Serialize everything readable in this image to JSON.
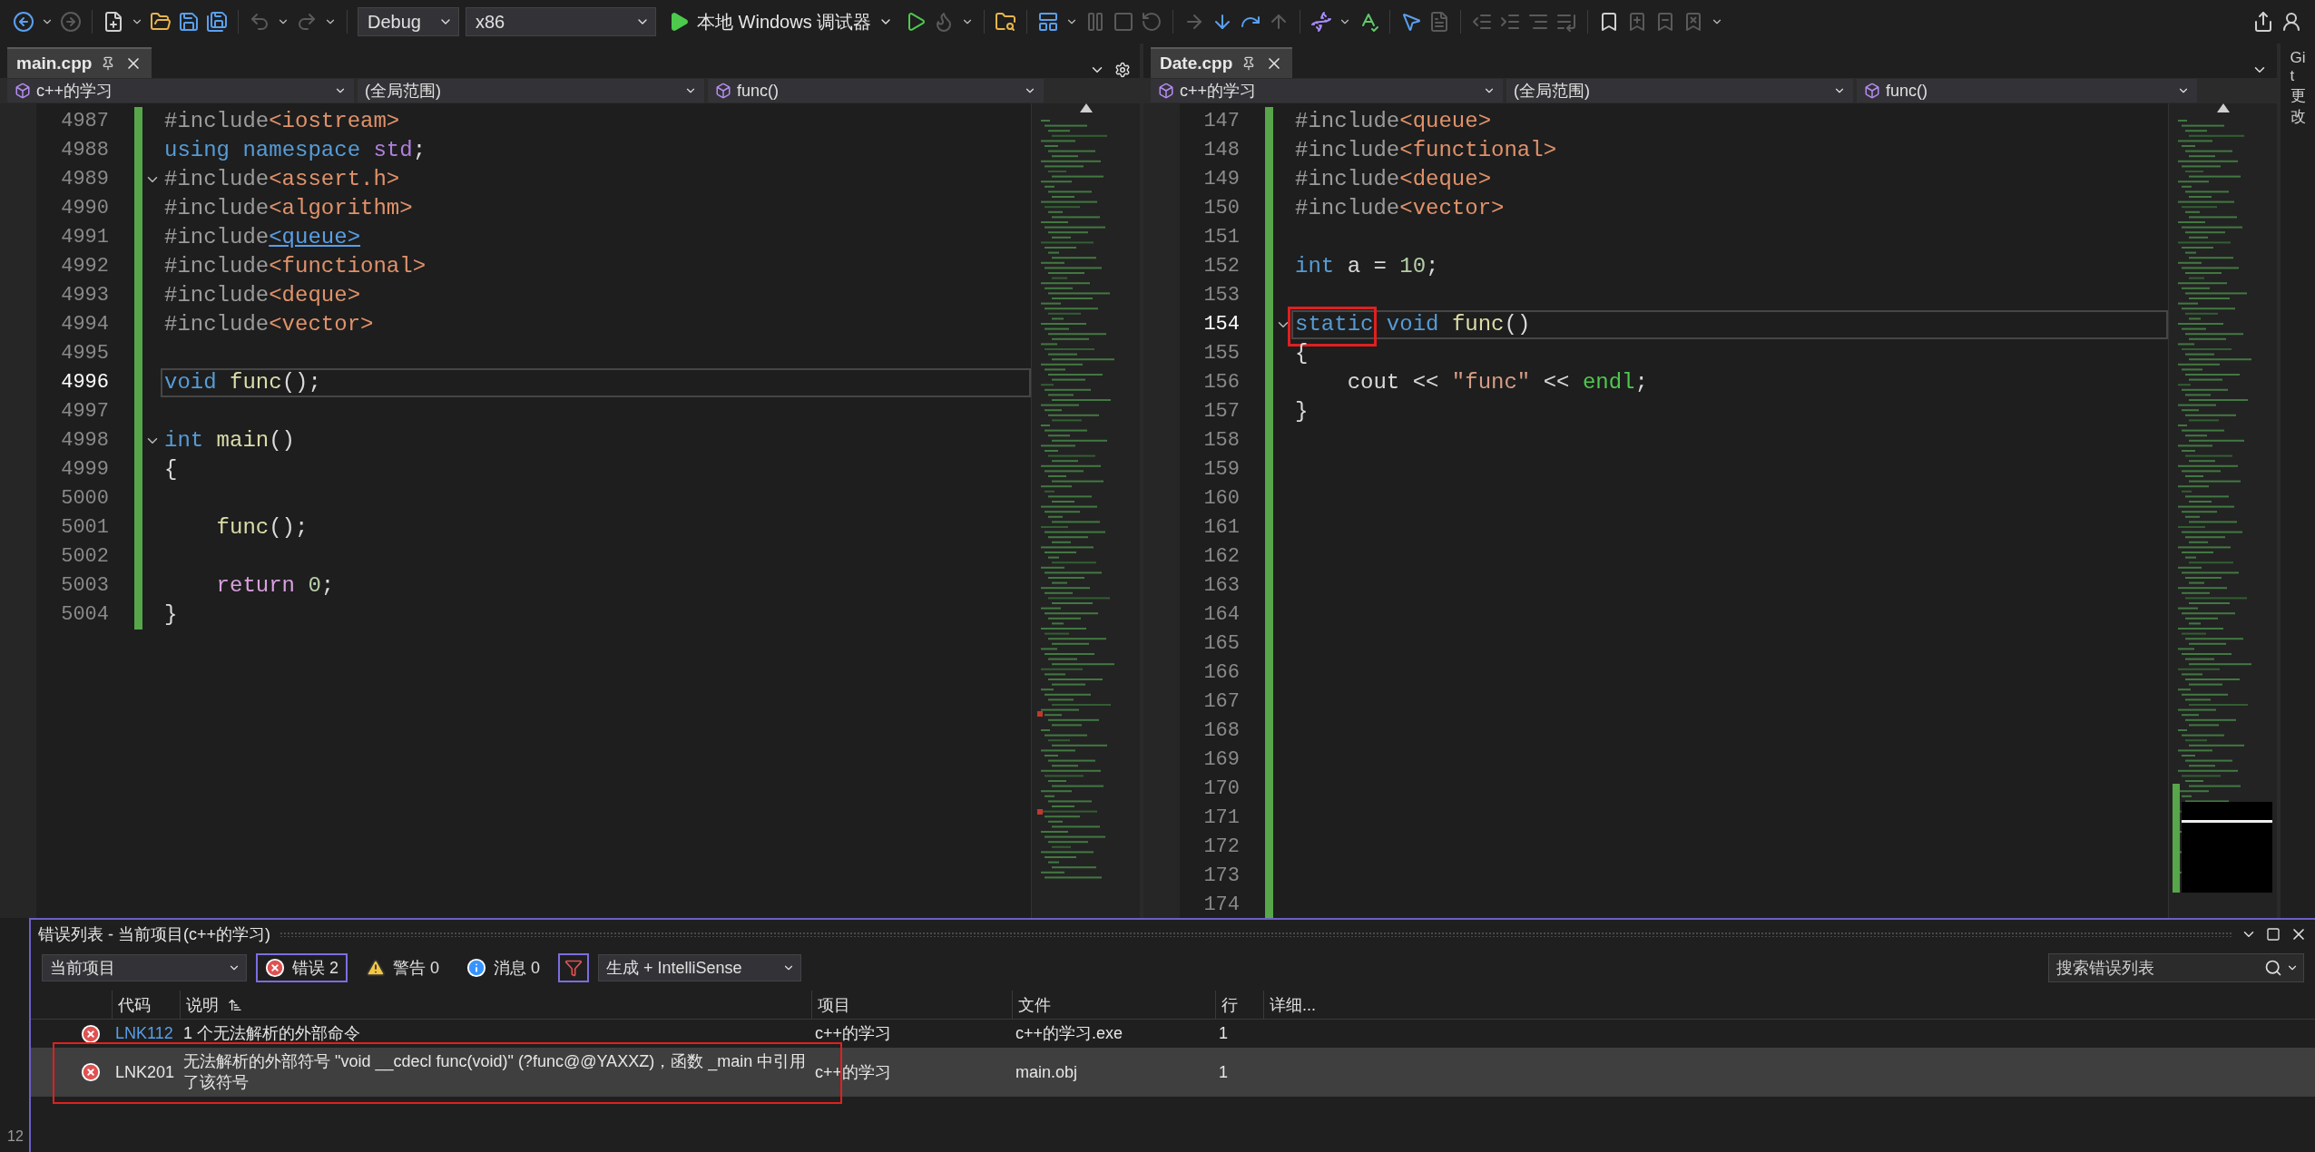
{
  "toolbar": {
    "configuration": "Debug",
    "platform": "x86",
    "run_label": "本地 Windows 调试器",
    "icon_buttons": [
      {
        "disabled": false
      },
      {
        "disabled": true
      },
      {
        "disabled": false
      },
      {
        "disabled": false
      },
      {
        "disabled": false
      },
      {
        "disabled": false
      },
      {
        "disabled": true
      },
      {
        "disabled": true
      },
      {
        "disabled": false
      },
      {
        "disabled": true
      },
      {
        "disabled": false
      },
      {
        "disabled": false
      },
      {
        "disabled": true
      },
      {
        "disabled": true
      },
      {
        "disabled": true
      },
      {
        "disabled": true
      },
      {
        "disabled": false
      },
      {
        "disabled": false
      },
      {
        "disabled": true
      },
      {
        "disabled": false
      },
      {
        "disabled": false
      },
      {
        "disabled": false
      },
      {
        "disabled": true
      },
      {
        "disabled": true
      },
      {
        "disabled": true
      },
      {
        "disabled": true
      },
      {
        "disabled": true
      },
      {
        "disabled": false
      },
      {
        "disabled": true
      },
      {
        "disabled": true
      },
      {
        "disabled": true
      }
    ]
  },
  "editors": [
    {
      "tab": "main.cpp",
      "project": "c++的学习",
      "scope": "(全局范围)",
      "member": "func()",
      "lines": [
        {
          "number": "4987",
          "tokens": [
            {
              "kind": "directive",
              "text": "#include"
            },
            {
              "kind": "header",
              "text": "<iostream>"
            }
          ]
        },
        {
          "number": "4988",
          "tokens": [
            {
              "kind": "keyword",
              "text": "using "
            },
            {
              "kind": "keyword",
              "text": "namespace "
            },
            {
              "kind": "namespace",
              "text": "std"
            },
            {
              "kind": "plain",
              "text": ";"
            }
          ]
        },
        {
          "number": "4989",
          "fold": true,
          "tokens": [
            {
              "kind": "directive",
              "text": "#include"
            },
            {
              "kind": "header",
              "text": "<assert.h>"
            }
          ]
        },
        {
          "number": "4990",
          "tokens": [
            {
              "kind": "directive",
              "text": "#include"
            },
            {
              "kind": "header",
              "text": "<algorithm>"
            }
          ]
        },
        {
          "number": "4991",
          "tokens": [
            {
              "kind": "directive",
              "text": "#include"
            },
            {
              "kind": "link",
              "text": "<queue>"
            }
          ]
        },
        {
          "number": "4992",
          "tokens": [
            {
              "kind": "directive",
              "text": "#include"
            },
            {
              "kind": "header",
              "text": "<functional>"
            }
          ]
        },
        {
          "number": "4993",
          "tokens": [
            {
              "kind": "directive",
              "text": "#include"
            },
            {
              "kind": "header",
              "text": "<deque>"
            }
          ]
        },
        {
          "number": "4994",
          "tokens": [
            {
              "kind": "directive",
              "text": "#include"
            },
            {
              "kind": "header",
              "text": "<vector>"
            }
          ]
        },
        {
          "number": "4995"
        },
        {
          "number": "4996",
          "current": true,
          "tokens": [
            {
              "kind": "keyword",
              "text": "void "
            },
            {
              "kind": "function",
              "text": "func"
            },
            {
              "kind": "plain",
              "text": "();"
            }
          ]
        },
        {
          "number": "4997"
        },
        {
          "number": "4998",
          "fold": true,
          "tokens": [
            {
              "kind": "keyword",
              "text": "int "
            },
            {
              "kind": "function",
              "text": "main"
            },
            {
              "kind": "plain",
              "text": "()"
            }
          ]
        },
        {
          "number": "4999",
          "tokens": [
            {
              "kind": "plain",
              "text": "{"
            }
          ]
        },
        {
          "number": "5000"
        },
        {
          "number": "5001",
          "tokens": [
            {
              "kind": "function",
              "text": "    func"
            },
            {
              "kind": "plain",
              "text": "();"
            }
          ]
        },
        {
          "number": "5002"
        },
        {
          "number": "5003",
          "tokens": [
            {
              "kind": "control",
              "text": "    return "
            },
            {
              "kind": "number",
              "text": "0"
            },
            {
              "kind": "plain",
              "text": ";"
            }
          ]
        },
        {
          "number": "5004",
          "tokens": [
            {
              "kind": "plain",
              "text": "}"
            }
          ]
        }
      ]
    },
    {
      "tab": "Date.cpp",
      "project": "c++的学习",
      "scope": "(全局范围)",
      "member": "func()",
      "lines": [
        {
          "number": "147",
          "tokens": [
            {
              "kind": "directive",
              "text": "#include"
            },
            {
              "kind": "header",
              "text": "<queue>"
            }
          ]
        },
        {
          "number": "148",
          "tokens": [
            {
              "kind": "directive",
              "text": "#include"
            },
            {
              "kind": "header",
              "text": "<functional>"
            }
          ]
        },
        {
          "number": "149",
          "tokens": [
            {
              "kind": "directive",
              "text": "#include"
            },
            {
              "kind": "header",
              "text": "<deque>"
            }
          ]
        },
        {
          "number": "150",
          "tokens": [
            {
              "kind": "directive",
              "text": "#include"
            },
            {
              "kind": "header",
              "text": "<vector>"
            }
          ]
        },
        {
          "number": "151"
        },
        {
          "number": "152",
          "tokens": [
            {
              "kind": "keyword",
              "text": "int "
            },
            {
              "kind": "plain",
              "text": "a = "
            },
            {
              "kind": "number",
              "text": "10"
            },
            {
              "kind": "plain",
              "text": ";"
            }
          ]
        },
        {
          "number": "153"
        },
        {
          "number": "154",
          "fold": true,
          "current": true,
          "tokens": [
            {
              "kind": "keyword",
              "text": "static ",
              "annotated": true
            },
            {
              "kind": "keyword",
              "text": "void "
            },
            {
              "kind": "function",
              "text": "func"
            },
            {
              "kind": "plain",
              "text": "()"
            }
          ]
        },
        {
          "number": "155",
          "tokens": [
            {
              "kind": "plain",
              "text": "{"
            }
          ]
        },
        {
          "number": "156",
          "tokens": [
            {
              "kind": "plain",
              "text": "    cout << "
            },
            {
              "kind": "string",
              "text": "\"func\""
            },
            {
              "kind": "plain",
              "text": " << "
            },
            {
              "kind": "stream",
              "text": "endl"
            },
            {
              "kind": "plain",
              "text": ";"
            }
          ]
        },
        {
          "number": "157",
          "tokens": [
            {
              "kind": "plain",
              "text": "}"
            }
          ]
        },
        {
          "number": "158"
        },
        {
          "number": "159"
        },
        {
          "number": "160"
        },
        {
          "number": "161"
        },
        {
          "number": "162"
        },
        {
          "number": "163"
        },
        {
          "number": "164"
        },
        {
          "number": "165"
        },
        {
          "number": "166"
        },
        {
          "number": "167"
        },
        {
          "number": "168"
        },
        {
          "number": "169"
        },
        {
          "number": "170"
        },
        {
          "number": "171"
        },
        {
          "number": "172"
        },
        {
          "number": "173"
        },
        {
          "number": "174"
        }
      ]
    }
  ],
  "side_tab": "Git 更改",
  "error_list": {
    "title": "错误列表 - 当前项目(c++的学习)",
    "scope": "当前项目",
    "filters": [
      {
        "kind": "error",
        "label": "错误 2",
        "selected": true
      },
      {
        "kind": "warning",
        "label": "警告 0",
        "selected": false
      },
      {
        "kind": "message",
        "label": "消息 0",
        "selected": false
      }
    ],
    "filter_toggle_selected": true,
    "source": "生成 + IntelliSense",
    "search": {
      "placeholder": "搜索错误列表"
    },
    "columns": [
      {
        "label": "代码",
        "sorted": false
      },
      {
        "label": "说明",
        "sorted": true
      },
      {
        "label": "项目",
        "sorted": false
      },
      {
        "label": "文件",
        "sorted": false
      },
      {
        "label": "行",
        "sorted": false
      },
      {
        "label": "详细...",
        "sorted": false
      }
    ],
    "rows": [
      {
        "code": "LNK112",
        "description": "1 个无法解析的外部命令",
        "project": "c++的学习",
        "file": "c++的学习.exe",
        "line": "1",
        "selected": false,
        "annotated": false
      },
      {
        "code": "LNK201",
        "description": "无法解析的外部符号 \"void __cdecl func(void)\" (?func@@YAXXZ)，函数 _main 中引用了该符号",
        "project": "c++的学习",
        "file": "main.obj",
        "line": "1",
        "selected": true,
        "annotated": true
      }
    ]
  },
  "status_fragment": "12"
}
